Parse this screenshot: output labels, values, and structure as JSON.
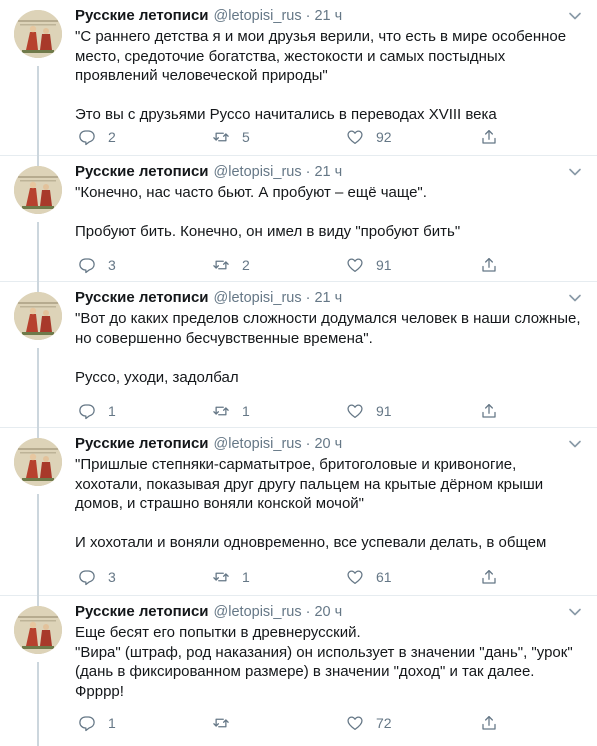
{
  "account": {
    "name": "Русские летописи",
    "handle": "@letopisi_rus",
    "separator": "·"
  },
  "tweets": [
    {
      "time": "21 ч",
      "text": "\"С раннего детства я и мои друзья верили, что есть в мире особенное место, средоточие богатства, жестокости и самых постыдных проявлений человеческой природы\"\n\nЭто вы с друзьями Руссо начитались в переводах XVIII века",
      "replies": "2",
      "retweets": "5",
      "likes": "92"
    },
    {
      "time": "21 ч",
      "text": "\"Конечно, нас часто бьют. А пробуют – ещё чаще\".\n\nПробуют бить. Конечно, он имел в виду \"пробуют бить\"",
      "replies": "3",
      "retweets": "2",
      "likes": "91"
    },
    {
      "time": "21 ч",
      "text": "\"Вот до каких пределов сложности додумался человек в наши сложные, но совершенно бесчувственные времена\".\n\nРуссо, уходи, задолбал",
      "replies": "1",
      "retweets": "1",
      "likes": "91"
    },
    {
      "time": "20 ч",
      "text": "\"Пришлые степняки-сарматытрое, бритоголовые и кривоногие, хохотали, показывая друг другу пальцем на крытые дёрном крыши домов, и страшно воняли конской мочой\"\n\nИ хохотали и воняли одновременно, все успевали делать, в общем",
      "replies": "3",
      "retweets": "1",
      "likes": "61"
    },
    {
      "time": "20 ч",
      "text": "Еще бесят его попытки в древнерусский.\n\"Вира\" (штраф, род наказания) он использует в значении \"дань\", \"урок\" (дань в фиксированном размере) в значении \"доход\" и так далее. Фрррр!",
      "replies": "1",
      "retweets": "",
      "likes": "72"
    }
  ],
  "icons": {
    "reply": "reply-icon",
    "retweet": "retweet-icon",
    "like": "like-icon",
    "share": "share-icon",
    "caret": "chevron-down-icon"
  },
  "colors": {
    "text": "#14171a",
    "secondary": "#657786",
    "thread": "#ccd6dd",
    "divider": "#e6ecf0"
  }
}
